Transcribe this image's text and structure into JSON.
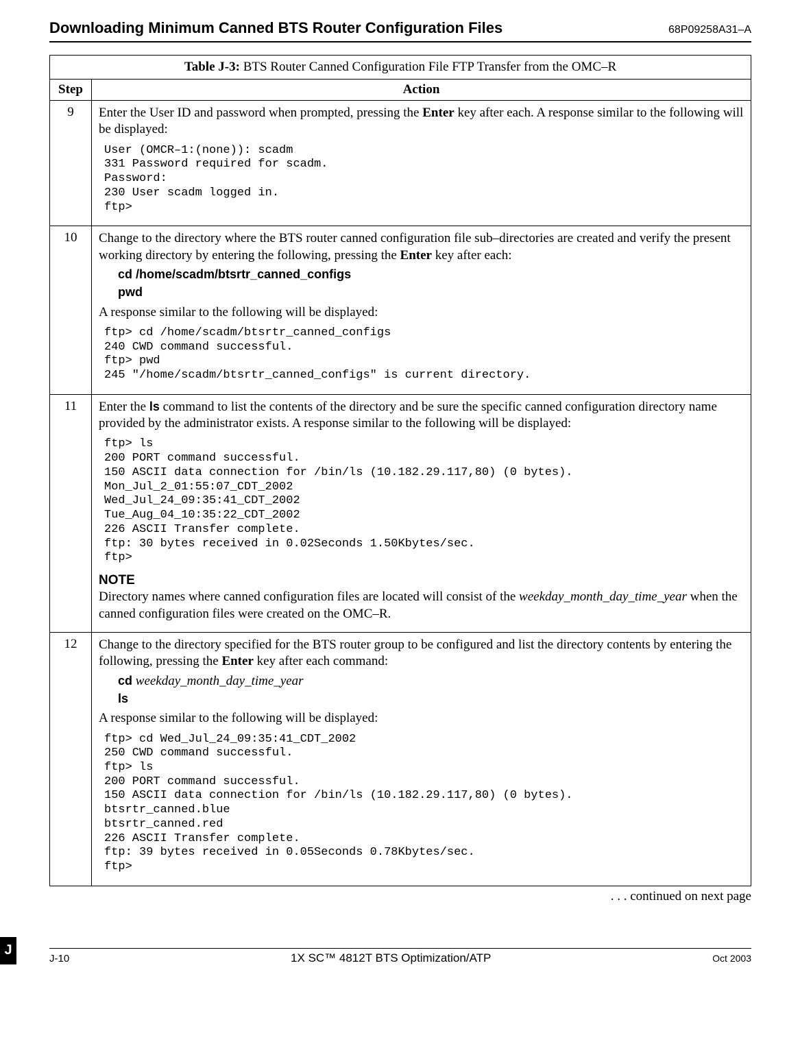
{
  "header": {
    "title": "Downloading Minimum Canned BTS Router Configuration Files",
    "doc_id": "68P09258A31–A"
  },
  "table": {
    "title_bold": "Table J-3:",
    "title_rest": " BTS Router Canned Configuration File FTP Transfer from the OMC–R",
    "col_step": "Step",
    "col_action": "Action"
  },
  "rows": {
    "r9": {
      "step": "9",
      "para_a": "Enter  the User ID and password when prompted, pressing the ",
      "para_b": "Enter",
      "para_c": " key after each. A response similar to the following will be displayed:",
      "code": "User (OMCR–1:(none)): scadm\n331 Password required for scadm.\nPassword:\n230 User scadm logged in.\nftp>"
    },
    "r10": {
      "step": "10",
      "para_a": "Change to the directory where the BTS router canned configuration file sub–directories are created and verify the present working directory by entering the following, pressing the ",
      "para_b": "Enter",
      "para_c": " key after each:",
      "cmd1_b": "cd",
      "cmd1_r": "  /home/scadm/btsrtr_canned_configs",
      "cmd2_b": "pwd",
      "resp_intro": "A response similar to the following will be displayed:",
      "code": "ftp> cd /home/scadm/btsrtr_canned_configs\n240 CWD command successful.\nftp> pwd\n245 \"/home/scadm/btsrtr_canned_configs\" is current directory."
    },
    "r11": {
      "step": "11",
      "para_a": "Enter the ",
      "para_b": "ls",
      "para_c": " command to list the contents of the directory and be sure the specific canned configuration directory name provided by the administrator exists. A response similar to the following will be displayed:",
      "code": "ftp> ls\n200 PORT command successful.\n150 ASCII data connection for /bin/ls (10.182.29.117,80) (0 bytes).\nMon_Jul_2_01:55:07_CDT_2002\nWed_Jul_24_09:35:41_CDT_2002\nTue_Aug_04_10:35:22_CDT_2002\n226 ASCII Transfer complete.\nftp: 30 bytes received in 0.02Seconds 1.50Kbytes/sec.\nftp>",
      "note_h": "NOTE",
      "note_a": "Directory names where canned configuration files are located will consist of the ",
      "note_i": "weekday_month_day_time_year",
      "note_c": " when the canned configuration files were created on the OMC–R."
    },
    "r12": {
      "step": "12",
      "para_a": "Change to the directory specified for the BTS router group to be configured and list the directory contents by entering the following, pressing the ",
      "para_b": "Enter",
      "para_c": " key after each command:",
      "cmd1_b": "cd",
      "cmd1_i": "  weekday_month_day_time_year",
      "cmd2_b": "ls",
      "resp_intro": "A response similar to the following will be displayed:",
      "code": "ftp> cd Wed_Jul_24_09:35:41_CDT_2002\n250 CWD command successful.\nftp> ls\n200 PORT command successful.\n150 ASCII data connection for /bin/ls (10.182.29.117,80) (0 bytes).\nbtsrtr_canned.blue\nbtsrtr_canned.red\n226 ASCII Transfer complete.\nftp: 39 bytes received in 0.05Seconds 0.78Kbytes/sec.\nftp>"
    }
  },
  "continued": " . . . continued on next page",
  "footer": {
    "tab": "J",
    "left": "J-10",
    "center": "1X SC™ 4812T BTS Optimization/ATP",
    "right": "Oct 2003"
  }
}
